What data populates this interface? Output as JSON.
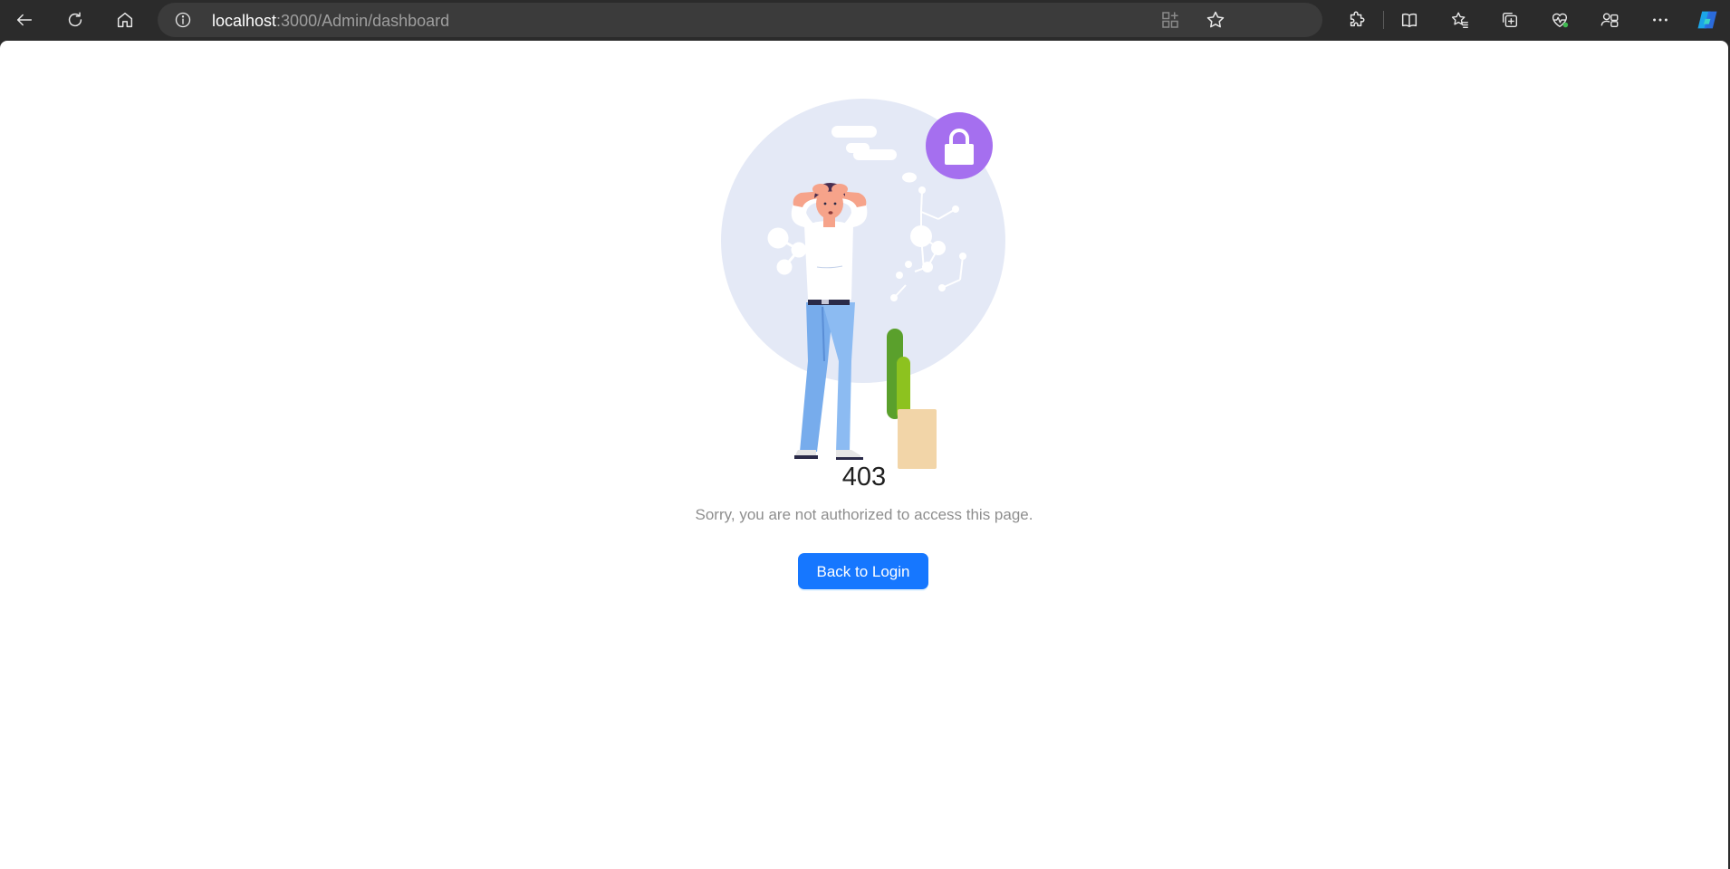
{
  "browser": {
    "url_host": "localhost",
    "url_rest": ":3000/Admin/dashboard",
    "icons": {
      "back": "back-arrow-icon",
      "reload": "reload-icon",
      "home": "home-icon",
      "site_info": "info-icon",
      "app_available": "app-available-icon",
      "favorite": "star-icon",
      "extensions": "extensions-icon",
      "split_screen": "split-screen-icon",
      "favorites": "favorites-icon",
      "collections": "collections-icon",
      "browser_essentials": "heart-pulse-icon",
      "profile_sharing": "profile-icon",
      "more": "more-icon",
      "copilot": "copilot-icon"
    },
    "accent_colors": {
      "chrome_bg": "#2b2b2b",
      "address_bar_bg": "#3b3b3b"
    }
  },
  "page": {
    "status_code": "403",
    "message": "Sorry, you are not authorized to access this page.",
    "back_button_label": "Back to Login",
    "colors": {
      "primary_button": "#1677ff",
      "lock_badge": "#a56fef",
      "background_circle": "#e4e9f6"
    }
  }
}
